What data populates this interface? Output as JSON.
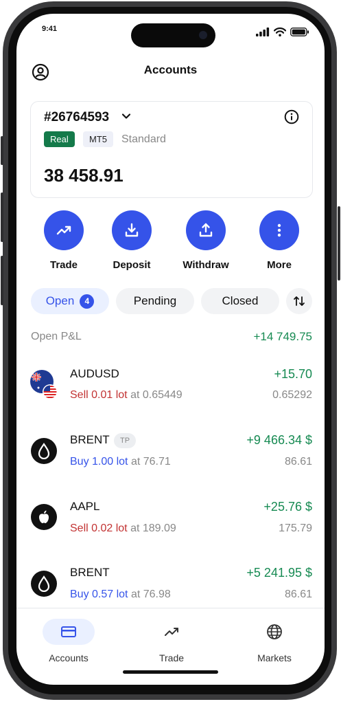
{
  "status": {
    "time": "9:41"
  },
  "header": {
    "title": "Accounts"
  },
  "account": {
    "id": "#26764593",
    "type_tag": "Real",
    "platform_tag": "MT5",
    "plan": "Standard",
    "balance": "38 458.91"
  },
  "actions": [
    {
      "label": "Trade",
      "icon": "trend-up-icon"
    },
    {
      "label": "Deposit",
      "icon": "download-icon"
    },
    {
      "label": "Withdraw",
      "icon": "upload-icon"
    },
    {
      "label": "More",
      "icon": "more-vertical-icon"
    }
  ],
  "filters": {
    "open_label": "Open",
    "open_count": "4",
    "pending_label": "Pending",
    "closed_label": "Closed"
  },
  "summary": {
    "label": "Open P&L",
    "value": "+14 749.75"
  },
  "positions": [
    {
      "symbol": "AUDUSD",
      "side_text": "Sell 0.01 lot",
      "at_text": "at 0.65449",
      "pnl": "+15.70",
      "current": "0.65292",
      "side": "sell",
      "icon": "au-us-flag-icon"
    },
    {
      "symbol": "BRENT",
      "tag": "TP",
      "side_text": "Buy 1.00 lot",
      "at_text": "at 76.71",
      "pnl": "+9 466.34 $",
      "current": "86.61",
      "side": "buy",
      "icon": "oil-drop-icon"
    },
    {
      "symbol": "AAPL",
      "side_text": "Sell 0.02 lot",
      "at_text": "at 189.09",
      "pnl": "+25.76 $",
      "current": "175.79",
      "side": "sell",
      "icon": "apple-icon"
    },
    {
      "symbol": "BRENT",
      "side_text": "Buy 0.57 lot",
      "at_text": "at 76.98",
      "pnl": "+5 241.95 $",
      "current": "86.61",
      "side": "buy",
      "icon": "oil-drop-icon"
    }
  ],
  "bottom_nav": [
    {
      "label": "Accounts",
      "icon": "card-icon",
      "active": true
    },
    {
      "label": "Trade",
      "icon": "trend-up-icon",
      "active": false
    },
    {
      "label": "Markets",
      "icon": "globe-icon",
      "active": false
    }
  ],
  "colors": {
    "accent": "#3553e9",
    "positive": "#168a52",
    "sell": "#c23232",
    "real_tag": "#147a4a"
  }
}
